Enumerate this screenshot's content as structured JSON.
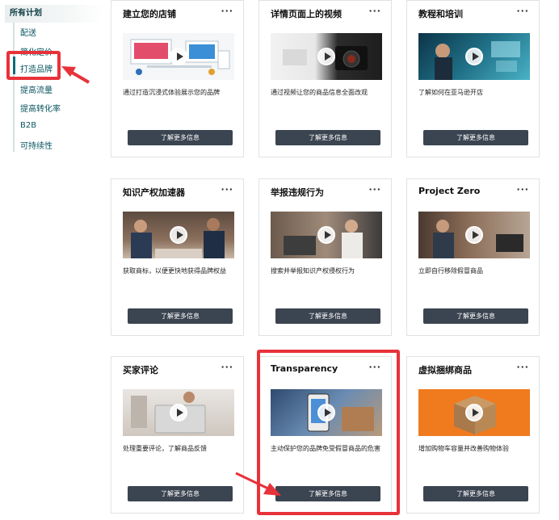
{
  "sidebar": {
    "title": "所有计划",
    "items": [
      {
        "label": "配送"
      },
      {
        "label": "简化定价"
      },
      {
        "label": "打造品牌"
      },
      {
        "label": "提高流量"
      },
      {
        "label": "提高转化率"
      },
      {
        "label": "B2B"
      },
      {
        "label": "可持续性"
      }
    ]
  },
  "cards": [
    {
      "title": "建立您的店铺",
      "more": "···",
      "desc": "通过打造沉浸式体验展示您的品牌",
      "button": "了解更多信息"
    },
    {
      "title": "详情页面上的视频",
      "more": "···",
      "desc": "通过视频让您的商品信息全面改观",
      "button": "了解更多信息"
    },
    {
      "title": "教程和培训",
      "more": "···",
      "desc": "了解如何在亚马逊开店",
      "button": "了解更多信息"
    },
    {
      "title": "知识产权加速器",
      "more": "···",
      "desc": "获取商标，以便更快地获得品牌权益",
      "button": "了解更多信息"
    },
    {
      "title": "举报违规行为",
      "more": "···",
      "desc": "搜索并举报知识产权侵权行为",
      "button": "了解更多信息"
    },
    {
      "title": "Project Zero",
      "more": "···",
      "desc": "立即自行移除假冒商品",
      "button": "了解更多信息"
    },
    {
      "title": "买家评论",
      "more": "···",
      "desc": "处理重要评论，了解商品反馈",
      "button": "了解更多信息"
    },
    {
      "title": "Transparency",
      "more": "···",
      "desc": "主动保护您的品牌免受假冒商品的危害",
      "button": "了解更多信息"
    },
    {
      "title": "虚拟捆绑商品",
      "more": "···",
      "desc": "增加购物车容量并改善购物体验",
      "button": "了解更多信息"
    }
  ],
  "colors": {
    "annotation": "#e8323a",
    "button": "#3b4451",
    "sidebar_link": "#0a5560"
  }
}
